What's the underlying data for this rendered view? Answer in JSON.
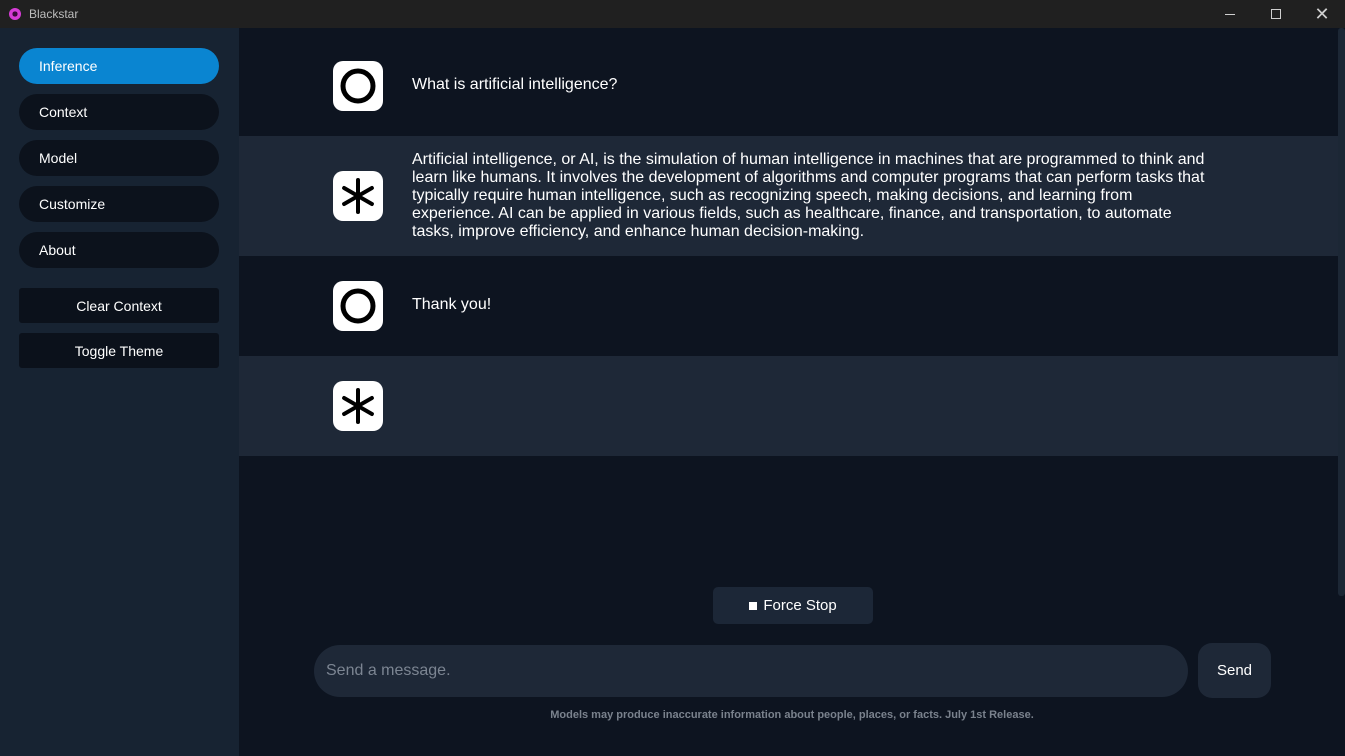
{
  "window": {
    "title": "Blackstar",
    "controls": [
      "minimize",
      "maximize",
      "close"
    ]
  },
  "sidebar": {
    "nav": [
      {
        "label": "Inference",
        "active": true
      },
      {
        "label": "Context",
        "active": false
      },
      {
        "label": "Model",
        "active": false
      },
      {
        "label": "Customize",
        "active": false
      },
      {
        "label": "About",
        "active": false
      }
    ],
    "buttons": {
      "clear_context": "Clear Context",
      "toggle_theme": "Toggle Theme"
    }
  },
  "chat": {
    "messages": [
      {
        "role": "user",
        "icon": "circle-icon",
        "text": "What is artificial intelligence?"
      },
      {
        "role": "assistant",
        "icon": "asterisk-icon",
        "text": "Artificial intelligence, or AI, is the simulation of human intelligence in machines that are programmed to think and learn like humans. It involves the development of algorithms and computer programs that can perform tasks that typically require human intelligence, such as recognizing speech, making decisions, and learning from experience. AI can be applied in various fields, such as healthcare, finance, and transportation, to automate tasks, improve efficiency, and enhance human decision-making."
      },
      {
        "role": "user",
        "icon": "circle-icon",
        "text": "Thank you!"
      },
      {
        "role": "assistant",
        "icon": "asterisk-icon",
        "text": ""
      }
    ]
  },
  "controls": {
    "force_stop": "Force Stop",
    "input_value": "",
    "input_placeholder": "Send a message.",
    "send": "Send"
  },
  "footer": {
    "disclaimer": "Models may produce inaccurate information about people, places, or facts. July 1st Release."
  },
  "colors": {
    "accent": "#0a85d1",
    "sidebar_bg": "#172332",
    "main_bg": "#0d1420",
    "assistant_row_bg": "#1e2837"
  }
}
